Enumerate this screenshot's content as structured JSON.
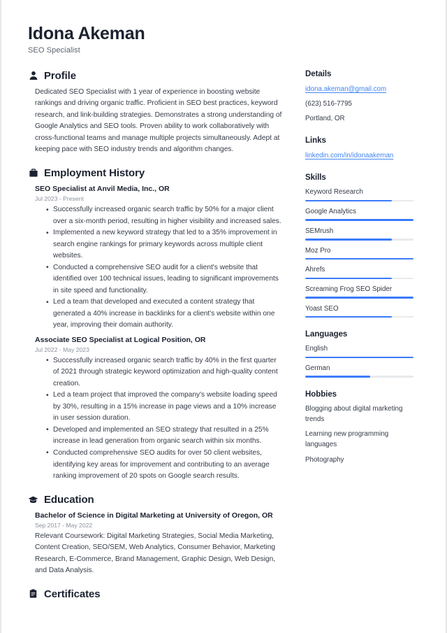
{
  "header": {
    "name": "Idona Akeman",
    "title": "SEO Specialist"
  },
  "accent_color": "#3b7bfc",
  "link_color": "#4285f4",
  "main": {
    "profile": {
      "icon": "person-icon",
      "heading": "Profile",
      "text": "Dedicated SEO Specialist with 1 year of experience in boosting website rankings and driving organic traffic. Proficient in SEO best practices, keyword research, and link-building strategies. Demonstrates a strong understanding of Google Analytics and SEO tools. Proven ability to work collaboratively with cross-functional teams and manage multiple projects simultaneously. Adept at keeping pace with SEO industry trends and algorithm changes."
    },
    "employment": {
      "icon": "briefcase-icon",
      "heading": "Employment History",
      "entries": [
        {
          "title": "SEO Specialist at Anvil Media, Inc., OR",
          "date": "Jul 2023 - Present",
          "bullets": [
            "Successfully increased organic search traffic by 50% for a major client over a six-month period, resulting in higher visibility and increased sales.",
            "Implemented a new keyword strategy that led to a 35% improvement in search engine rankings for primary keywords across multiple client websites.",
            "Conducted a comprehensive SEO audit for a client's website that identified over 100 technical issues, leading to significant improvements in site speed and functionality.",
            "Led a team that developed and executed a content strategy that generated a 40% increase in backlinks for a client's website within one year, improving their domain authority."
          ]
        },
        {
          "title": "Associate SEO Specialist at Logical Position, OR",
          "date": "Jul 2022 - May 2023",
          "bullets": [
            "Successfully increased organic search traffic by 40% in the first quarter of 2021 through strategic keyword optimization and high-quality content creation.",
            "Led a team project that improved the company's website loading speed by 30%, resulting in a 15% increase in page views and a 10% increase in user session duration.",
            "Developed and implemented an SEO strategy that resulted in a 25% increase in lead generation from organic search within six months.",
            "Conducted comprehensive SEO audits for over 50 client websites, identifying key areas for improvement and contributing to an average ranking improvement of 20 spots on Google search results."
          ]
        }
      ]
    },
    "education": {
      "icon": "graduation-cap-icon",
      "heading": "Education",
      "entries": [
        {
          "title": "Bachelor of Science in Digital Marketing at University of Oregon, OR",
          "date": "Sep 2017 - May 2022",
          "description": "Relevant Coursework: Digital Marketing Strategies, Social Media Marketing, Content Creation, SEO/SEM, Web Analytics, Consumer Behavior, Marketing Research, E-Commerce, Brand Management, Graphic Design, Web Design, and Data Analysis."
        }
      ]
    },
    "certificates": {
      "icon": "certificate-icon",
      "heading": "Certificates"
    }
  },
  "sidebar": {
    "details": {
      "heading": "Details",
      "email": "idona.akeman@gmail.com",
      "phone": "(623) 516-7795",
      "location": "Portland, OR"
    },
    "links": {
      "heading": "Links",
      "items": [
        {
          "label": "linkedin.com/in/idonaakeman"
        }
      ]
    },
    "skills": {
      "heading": "Skills",
      "items": [
        {
          "label": "Keyword Research",
          "level": 80
        },
        {
          "label": "Google Analytics",
          "level": 100
        },
        {
          "label": "SEMrush",
          "level": 80
        },
        {
          "label": "Moz Pro",
          "level": 100
        },
        {
          "label": "Ahrefs",
          "level": 80
        },
        {
          "label": "Screaming Frog SEO Spider",
          "level": 100
        },
        {
          "label": "Yoast SEO",
          "level": 80
        }
      ]
    },
    "languages": {
      "heading": "Languages",
      "items": [
        {
          "label": "English",
          "level": 100
        },
        {
          "label": "German",
          "level": 60
        }
      ]
    },
    "hobbies": {
      "heading": "Hobbies",
      "items": [
        {
          "label": "Blogging about digital marketing trends"
        },
        {
          "label": "Learning new programming languages"
        },
        {
          "label": "Photography"
        }
      ]
    }
  }
}
